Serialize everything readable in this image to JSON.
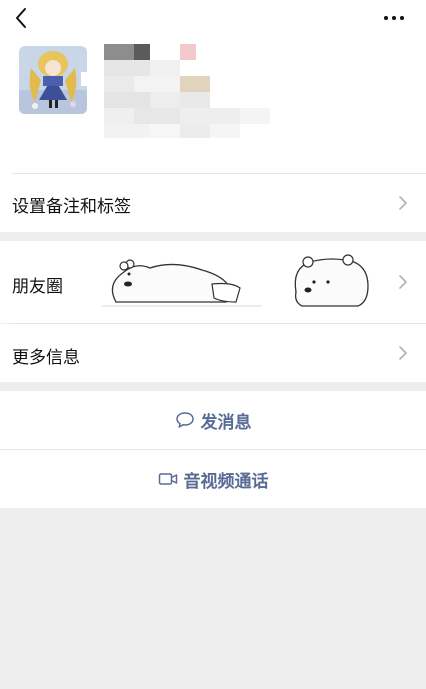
{
  "profile": {
    "avatar": "avatar-illustration",
    "name_hidden": true
  },
  "header": {
    "back_icon": "back-arrow-icon",
    "more_icon": "more-dots-icon"
  },
  "rows": {
    "remark_label": "设置备注和标签",
    "moments_label": "朋友圈",
    "more_info_label": "更多信息"
  },
  "actions": {
    "message_label": "发消息",
    "call_label": "音视频通话"
  },
  "colors": {
    "link": "#576b95",
    "background": "#ededed",
    "divider": "#e5e5e5"
  }
}
